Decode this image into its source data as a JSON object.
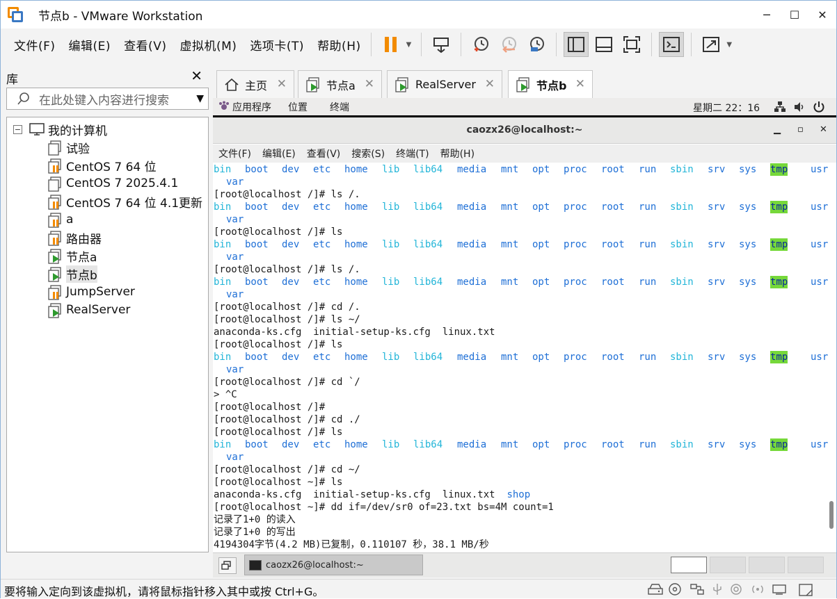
{
  "window": {
    "title": "节点b - VMware Workstation"
  },
  "menu": [
    "文件(F)",
    "编辑(E)",
    "查看(V)",
    "虚拟机(M)",
    "选项卡(T)",
    "帮助(H)"
  ],
  "library": {
    "title": "库",
    "search_placeholder": "在此处键入内容进行搜索",
    "tree": [
      {
        "label": "我的计算机",
        "icon": "computer-icon",
        "level": 0
      },
      {
        "label": "试验",
        "icon": "vm-off-icon",
        "level": 1
      },
      {
        "label": "CentOS 7 64 位",
        "icon": "vm-paused-icon",
        "level": 1
      },
      {
        "label": "CentOS 7 2025.4.1",
        "icon": "vm-off-icon",
        "level": 1
      },
      {
        "label": "CentOS 7 64 位 4.1更新",
        "icon": "vm-paused-icon",
        "level": 1
      },
      {
        "label": "a",
        "icon": "vm-paused-icon",
        "level": 1
      },
      {
        "label": "路由器",
        "icon": "vm-paused-icon",
        "level": 1
      },
      {
        "label": "节点a",
        "icon": "vm-running-icon",
        "level": 1
      },
      {
        "label": "节点b",
        "icon": "vm-running-icon",
        "level": 1,
        "selected": true
      },
      {
        "label": "JumpServer",
        "icon": "vm-paused-icon",
        "level": 1
      },
      {
        "label": "RealServer",
        "icon": "vm-running-icon",
        "level": 1
      }
    ]
  },
  "tabs": [
    {
      "label": "主页",
      "icon": "home-icon"
    },
    {
      "label": "节点a",
      "icon": "vm-running-icon"
    },
    {
      "label": "RealServer",
      "icon": "vm-running-icon"
    },
    {
      "label": "节点b",
      "icon": "vm-running-icon",
      "active": true
    }
  ],
  "guest": {
    "topbar": {
      "apps": "应用程序",
      "places": "位置",
      "terminal": "终端",
      "clock": "星期二 22：16"
    },
    "terminal": {
      "title": "caozx26@localhost:~",
      "menu": [
        "文件(F)",
        "编辑(E)",
        "查看(V)",
        "搜索(S)",
        "终端(T)",
        "帮助(H)"
      ],
      "ls_root": [
        "bin",
        "boot",
        "dev",
        "etc",
        "home",
        "lib",
        "lib64",
        "media",
        "mnt",
        "opt",
        "proc",
        "root",
        "run",
        "sbin",
        "srv",
        "sys",
        "tmp",
        "usr"
      ],
      "ls_root_wrap": "var",
      "lines": [
        {
          "type": "ls"
        },
        {
          "type": "text",
          "text": "[root@localhost /]# ls /."
        },
        {
          "type": "ls"
        },
        {
          "type": "text",
          "text": "[root@localhost /]# ls"
        },
        {
          "type": "ls"
        },
        {
          "type": "text",
          "text": "[root@localhost /]# ls /."
        },
        {
          "type": "ls"
        },
        {
          "type": "text",
          "text": "[root@localhost /]# cd /."
        },
        {
          "type": "text",
          "text": "[root@localhost /]# ls ~/"
        },
        {
          "type": "text",
          "text": "anaconda-ks.cfg  initial-setup-ks.cfg  linux.txt"
        },
        {
          "type": "text",
          "text": "[root@localhost /]# ls"
        },
        {
          "type": "ls"
        },
        {
          "type": "text",
          "text": "[root@localhost /]# cd `/"
        },
        {
          "type": "text",
          "text": "> ^C"
        },
        {
          "type": "text",
          "text": "[root@localhost /]#"
        },
        {
          "type": "text",
          "text": "[root@localhost /]# cd ./"
        },
        {
          "type": "text",
          "text": "[root@localhost /]# ls"
        },
        {
          "type": "ls"
        },
        {
          "type": "text",
          "text": "[root@localhost /]# cd ~/"
        },
        {
          "type": "text",
          "text": "[root@localhost ~]# ls"
        },
        {
          "type": "home_ls",
          "text": "anaconda-ks.cfg  initial-setup-ks.cfg  linux.txt  ",
          "dir": "shop"
        },
        {
          "type": "text",
          "text": "[root@localhost ~]# dd if=/dev/sr0 of=23.txt bs=4M count=1"
        },
        {
          "type": "text",
          "text": "记录了1+0 的读入"
        },
        {
          "type": "text",
          "text": "记录了1+0 的写出"
        },
        {
          "type": "text",
          "text": "4194304字节(4.2 MB)已复制，0.110107 秒，38.1 MB/秒"
        }
      ]
    },
    "taskbar": {
      "task_label": "caozx26@localhost:~"
    }
  },
  "status": {
    "text": "要将输入定向到该虚拟机，请将鼠标指针移入其中或按 Ctrl+G。"
  },
  "colors": {
    "dir": "#1e6fd6",
    "cyan": "#22b5d8",
    "tmp_bg": "#76d83a",
    "vm_orange": "#f28b00",
    "vm_green": "#2e9a2e"
  }
}
